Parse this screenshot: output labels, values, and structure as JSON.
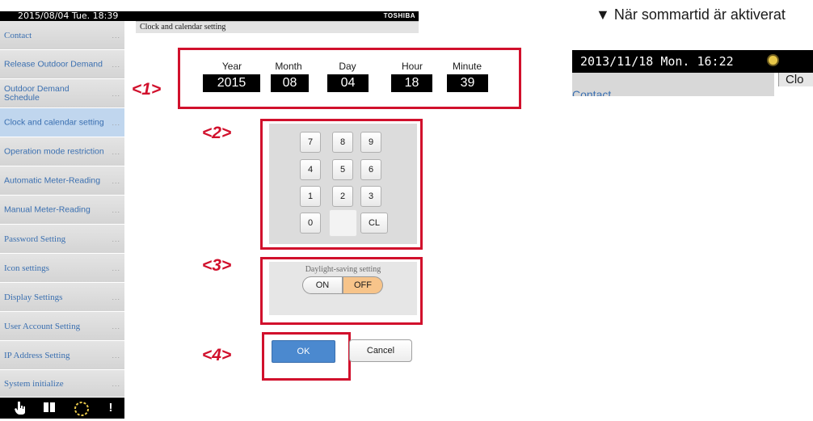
{
  "header": {
    "datetime": "2015/08/04 Tue. 18:39",
    "brand": "TOSHIBA"
  },
  "sidebar": {
    "items": [
      {
        "label": "Contact"
      },
      {
        "label": "Release Outdoor Demand"
      },
      {
        "label": "Outdoor Demand Schedule"
      },
      {
        "label": "Clock and calendar setting",
        "active": true
      },
      {
        "label": "Operation mode restriction"
      },
      {
        "label": "Automatic Meter-Reading"
      },
      {
        "label": "Manual Meter-Reading"
      },
      {
        "label": "Password Setting"
      },
      {
        "label": "Icon settings"
      },
      {
        "label": "Display Settings"
      },
      {
        "label": "User Account Setting"
      },
      {
        "label": "IP Address Setting"
      },
      {
        "label": "System initialize"
      }
    ],
    "dots": "...",
    "bottom_icons": [
      "hand-pointer-icon",
      "book-icon",
      "clock-icon",
      "alert-icon"
    ]
  },
  "content": {
    "title": "Clock and calendar setting",
    "datetime_fields": [
      {
        "label": "Year",
        "value": "2015"
      },
      {
        "label": "Month",
        "value": "08"
      },
      {
        "label": "Day",
        "value": "04"
      },
      {
        "label": "Hour",
        "value": "18"
      },
      {
        "label": "Minute",
        "value": "39"
      }
    ],
    "keypad": [
      "7",
      "8",
      "9",
      "4",
      "5",
      "6",
      "1",
      "2",
      "3",
      "0",
      "",
      "CL"
    ],
    "daylight": {
      "title": "Daylight-saving setting",
      "on_label": "ON",
      "off_label": "OFF",
      "selected": "OFF"
    },
    "ok_label": "OK",
    "cancel_label": "Cancel"
  },
  "callouts": [
    "<1>",
    "<2>",
    "<3>",
    "<4>"
  ],
  "annotation": {
    "note": "▼ När sommartid är aktiverat",
    "example_datetime": "2013/11/18  Mon.  16:22",
    "example_sidebar_label": "Contact",
    "example_content_label": "Clo"
  },
  "colors": {
    "highlight": "#d1102c",
    "ok_button": "#4b89cf",
    "off_selected": "#f7c48a",
    "sidebar_text": "#3a6fb0"
  }
}
